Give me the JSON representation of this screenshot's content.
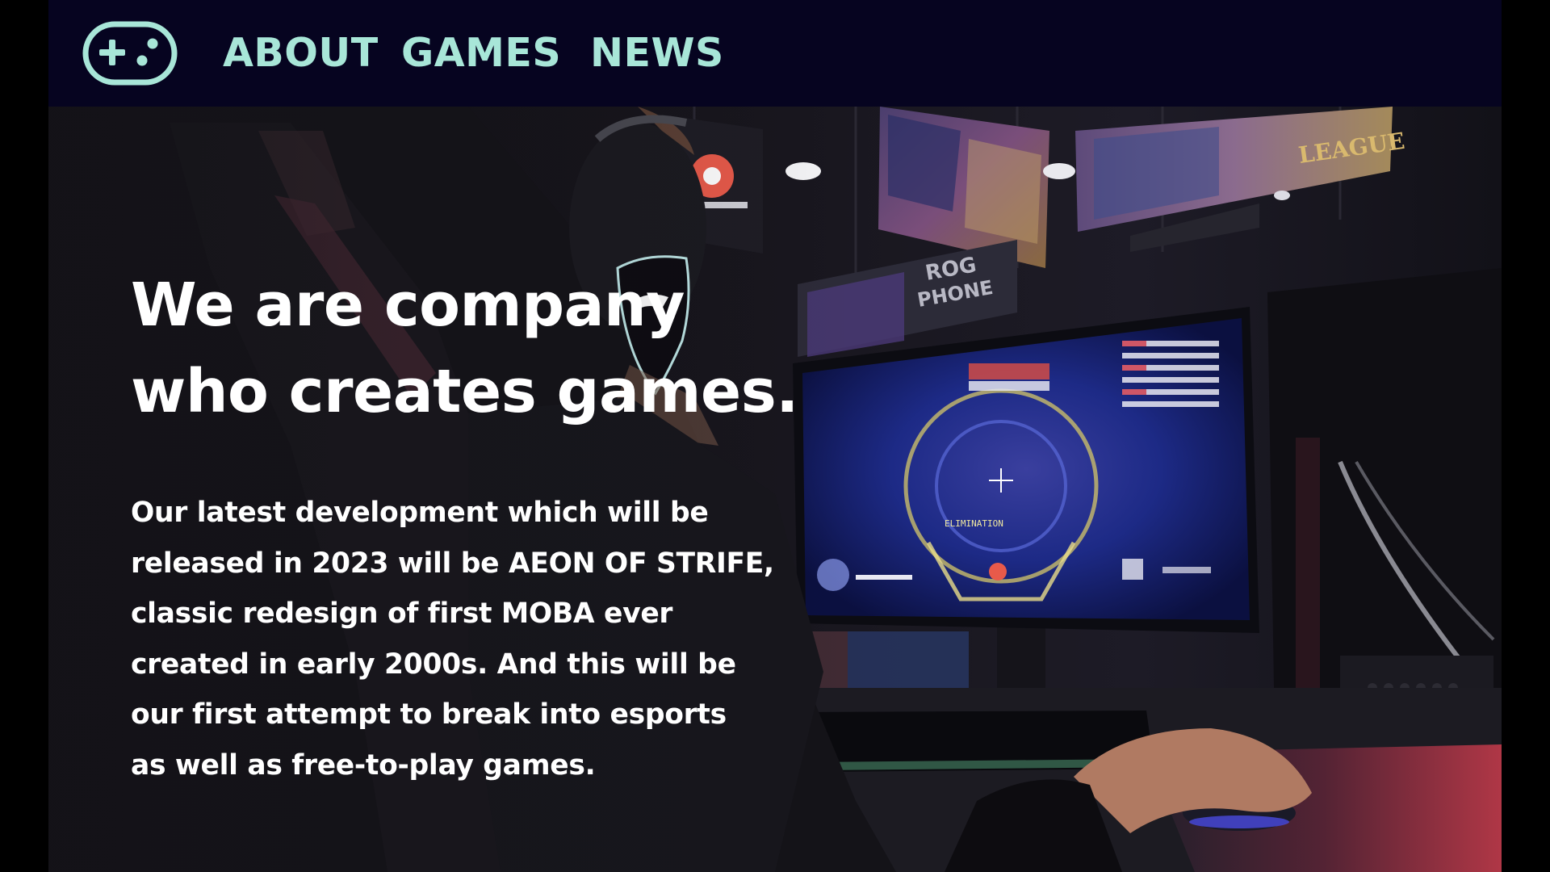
{
  "nav": {
    "logo_icon": "gamepad-icon",
    "items": [
      {
        "label": "ABOUT"
      },
      {
        "label": "GAMES"
      },
      {
        "label": "NEWS"
      }
    ],
    "link_color": "#a8e6d8",
    "background": "#060420"
  },
  "hero": {
    "background_image": "gamer-at-pc-esports-photo",
    "title_lines": [
      "We are company",
      "who creates games."
    ],
    "description_lines": [
      "Our latest development which will be",
      "released in 2023 will be AEON OF STRIFE,",
      "classic redesign of first MOBA ever",
      "created in early 2000s. And this will be",
      "our first attempt to break into esports",
      "as well as free-to-play games."
    ]
  }
}
